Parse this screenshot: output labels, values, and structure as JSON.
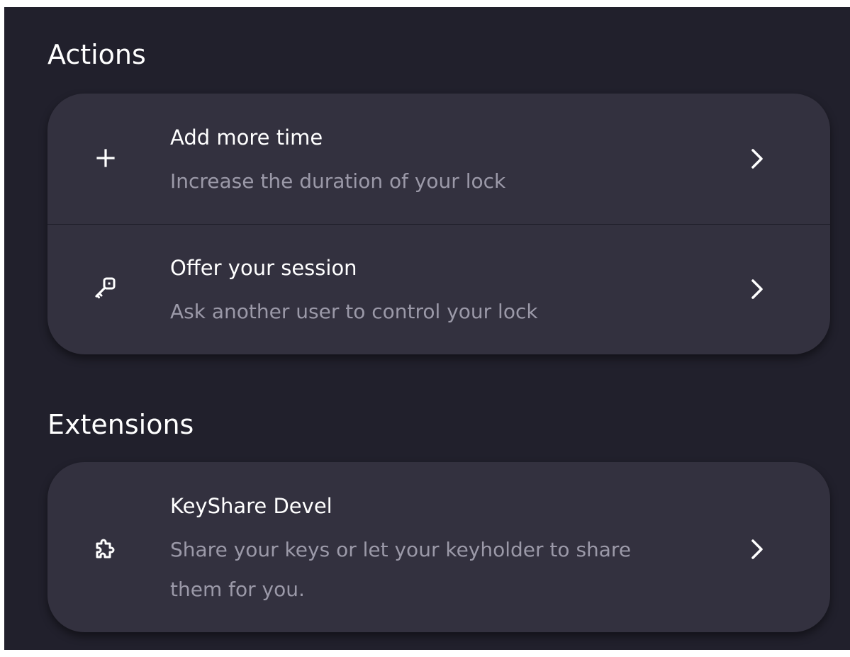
{
  "sections": [
    {
      "title": "Actions",
      "items": [
        {
          "icon": "plus-icon",
          "title": "Add more time",
          "description": "Increase the duration of your lock",
          "chevron": "chevron-right-icon"
        },
        {
          "icon": "key-icon",
          "title": "Offer your session",
          "description": "Ask another user to control your lock",
          "chevron": "chevron-right-icon"
        }
      ]
    },
    {
      "title": "Extensions",
      "items": [
        {
          "icon": "puzzle-icon",
          "title": "KeyShare Devel",
          "description_lines": [
            "Share your keys or let your keyholder to share",
            "them for you."
          ],
          "chevron": "chevron-right-icon"
        }
      ]
    }
  ],
  "colors": {
    "background": "#21202c",
    "card": "#33313f",
    "title_text": "#ffffff",
    "description_text": "#9b99a8"
  }
}
